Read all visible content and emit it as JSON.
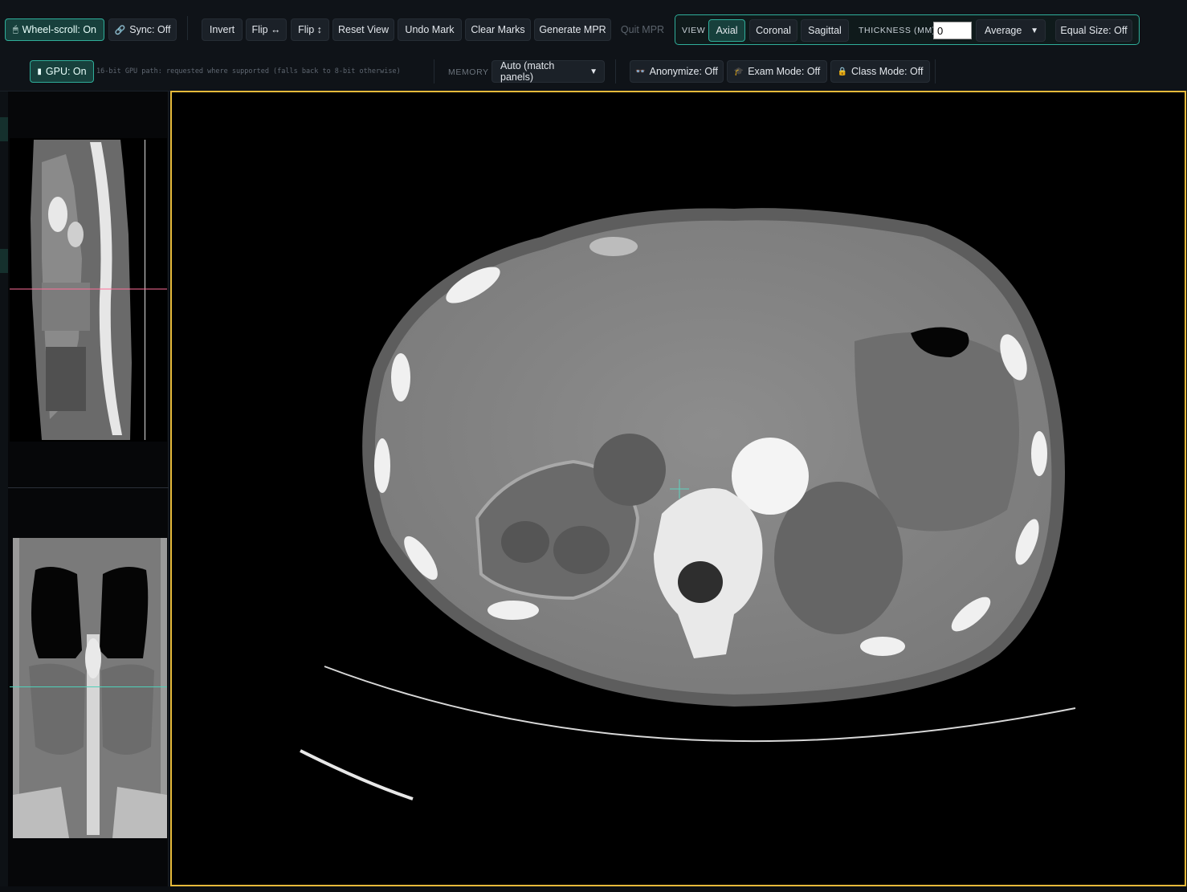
{
  "toolbar1": {
    "wheel_scroll": "Wheel-scroll: On",
    "sync": "Sync: Off",
    "invert": "Invert",
    "flip_h": "Flip ↔",
    "flip_v": "Flip ↕",
    "reset_view": "Reset View",
    "undo_mark": "Undo Mark",
    "clear_marks": "Clear Marks",
    "generate_mpr": "Generate MPR",
    "quit_mpr": "Quit MPR"
  },
  "view_group": {
    "label": "VIEW",
    "tabs": [
      {
        "label": "Axial",
        "active": true
      },
      {
        "label": "Coronal",
        "active": false
      },
      {
        "label": "Sagittal",
        "active": false
      }
    ],
    "thickness_label": "THICKNESS (MM)",
    "thickness_value": "0",
    "mode_selected": "Average",
    "equal_size": "Equal Size: Off"
  },
  "toolbar2": {
    "gpu": "GPU: On",
    "gpu_note": "16-bit GPU path: requested where supported (falls back to 8-bit otherwise)",
    "memory_label": "MEMORY",
    "memory_selected": "Auto (match panels)",
    "anonymize": "Anonymize: Off",
    "exam_mode": "Exam Mode: Off",
    "class_mode": "Class Mode: Off"
  },
  "colors": {
    "accent": "#2fae9a",
    "active_viewport_border": "#e5b93a",
    "sagittal_crosshair": "#ff6f9a",
    "coronal_crosshair": "#4fd1b8",
    "axial_crosshair": "#5fd3c0"
  },
  "icons": [
    "mouse-icon",
    "link-icon",
    "gpu-icon",
    "glasses-icon",
    "exam-icon",
    "lock-icon",
    "chevron-down-icon"
  ]
}
